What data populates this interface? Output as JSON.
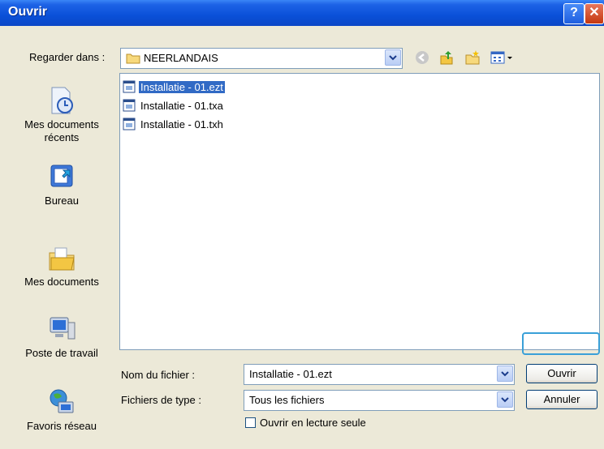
{
  "window": {
    "title": "Ouvrir",
    "help_glyph": "?",
    "close_glyph": "✕"
  },
  "lookin": {
    "label": "Regarder dans :",
    "value": "NEERLANDAIS"
  },
  "toolbar": {
    "icons": [
      "back-icon",
      "up-folder-icon",
      "new-folder-icon",
      "view-menu-icon"
    ]
  },
  "places": [
    {
      "label": "Mes documents\nrécents",
      "icon": "recent-documents-icon"
    },
    {
      "label": "Bureau",
      "icon": "desktop-icon"
    },
    {
      "label": "Mes documents",
      "icon": "my-documents-icon"
    },
    {
      "label": "Poste de travail",
      "icon": "my-computer-icon"
    },
    {
      "label": "Favoris réseau",
      "icon": "network-places-icon"
    }
  ],
  "files": [
    {
      "name": "Installatie - 01.ezt",
      "selected": true
    },
    {
      "name": "Installatie - 01.txa",
      "selected": false
    },
    {
      "name": "Installatie - 01.txh",
      "selected": false
    }
  ],
  "filename": {
    "label": "Nom du fichier :",
    "value": "Installatie - 01.ezt"
  },
  "filetype": {
    "label": "Fichiers de type :",
    "value": "Tous les fichiers"
  },
  "readonly": {
    "label": "Ouvrir en lecture seule",
    "checked": false
  },
  "buttons": {
    "open": "Ouvrir",
    "cancel": "Annuler"
  }
}
